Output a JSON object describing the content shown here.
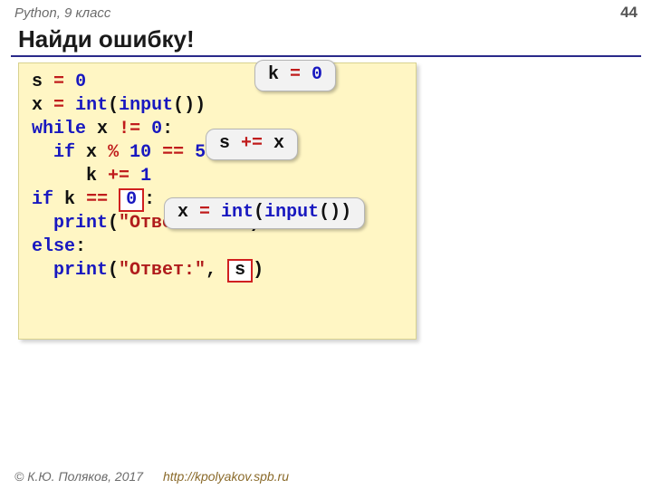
{
  "header": {
    "course": "Python, 9 класс",
    "page": "44"
  },
  "title": "Найди ошибку!",
  "code": {
    "l1_v": "s",
    "l1_init": "0",
    "l2_v": "x",
    "l2_int": "int",
    "l2_inp": "input",
    "l3_while": "while",
    "l3_v": "x",
    "l3_zero": "0",
    "l4_if": "if",
    "l4_v": "x",
    "l4_ten": "10",
    "l4_five": "5",
    "l5_k": "k",
    "l5_one": "1",
    "l6_if": "if",
    "l6_k": "k",
    "l6_patch": "0",
    "l7_print": "print",
    "l7_str": "\"Ответ: нет\"",
    "l8_else": "else",
    "l9_print": "print",
    "l9_str": "\"Ответ:\"",
    "l9_patch": "s"
  },
  "bubbles": {
    "b1": {
      "var": "k",
      "eq": " = ",
      "val": "0"
    },
    "b2": {
      "var": "s",
      "eq": " += ",
      "val": "x"
    },
    "b3": {
      "var": "x",
      "eq": " = ",
      "fn1": "int",
      "fn2": "input"
    }
  },
  "footer": {
    "copyright": "© К.Ю. Поляков, 2017",
    "url": "http://kpolyakov.spb.ru"
  }
}
